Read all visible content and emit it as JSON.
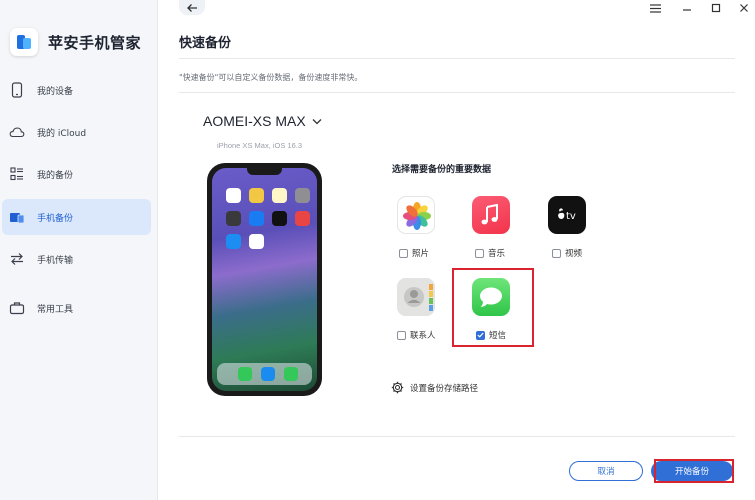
{
  "app": {
    "name": "苹安手机管家"
  },
  "sidebar": {
    "items": [
      {
        "label": "我的设备",
        "icon": "phone-icon"
      },
      {
        "label": "我的 iCloud",
        "icon": "cloud-icon"
      },
      {
        "label": "我的备份",
        "icon": "list-icon"
      },
      {
        "label": "手机备份",
        "icon": "devices-icon",
        "active": true
      },
      {
        "label": "手机传输",
        "icon": "transfer-icon"
      },
      {
        "label": "常用工具",
        "icon": "toolbox-icon"
      }
    ]
  },
  "header": {
    "title": "快速备份",
    "hint": "\"快速备份\"可以自定义备份数据，备份速度非常快。"
  },
  "device": {
    "name": "AOMEI-XS MAX",
    "subtitle": "iPhone XS Max, iOS 16.3"
  },
  "backup": {
    "section_title": "选择需要备份的重要数据",
    "items": [
      {
        "label": "照片",
        "icon": "photos-icon",
        "checked": false
      },
      {
        "label": "音乐",
        "icon": "music-icon",
        "checked": false
      },
      {
        "label": "视频",
        "icon": "appletv-icon",
        "checked": false
      },
      {
        "label": "联系人",
        "icon": "contacts-icon",
        "checked": false
      },
      {
        "label": "短信",
        "icon": "messages-icon",
        "checked": true
      }
    ],
    "path_label": "设置备份存储路径",
    "tv_text": "tv"
  },
  "actions": {
    "cancel": "取消",
    "start": "开始备份"
  },
  "colors": {
    "accent": "#2f6fd6",
    "highlight": "#d9232e",
    "sidebar_bg": "#f4f6f9"
  }
}
